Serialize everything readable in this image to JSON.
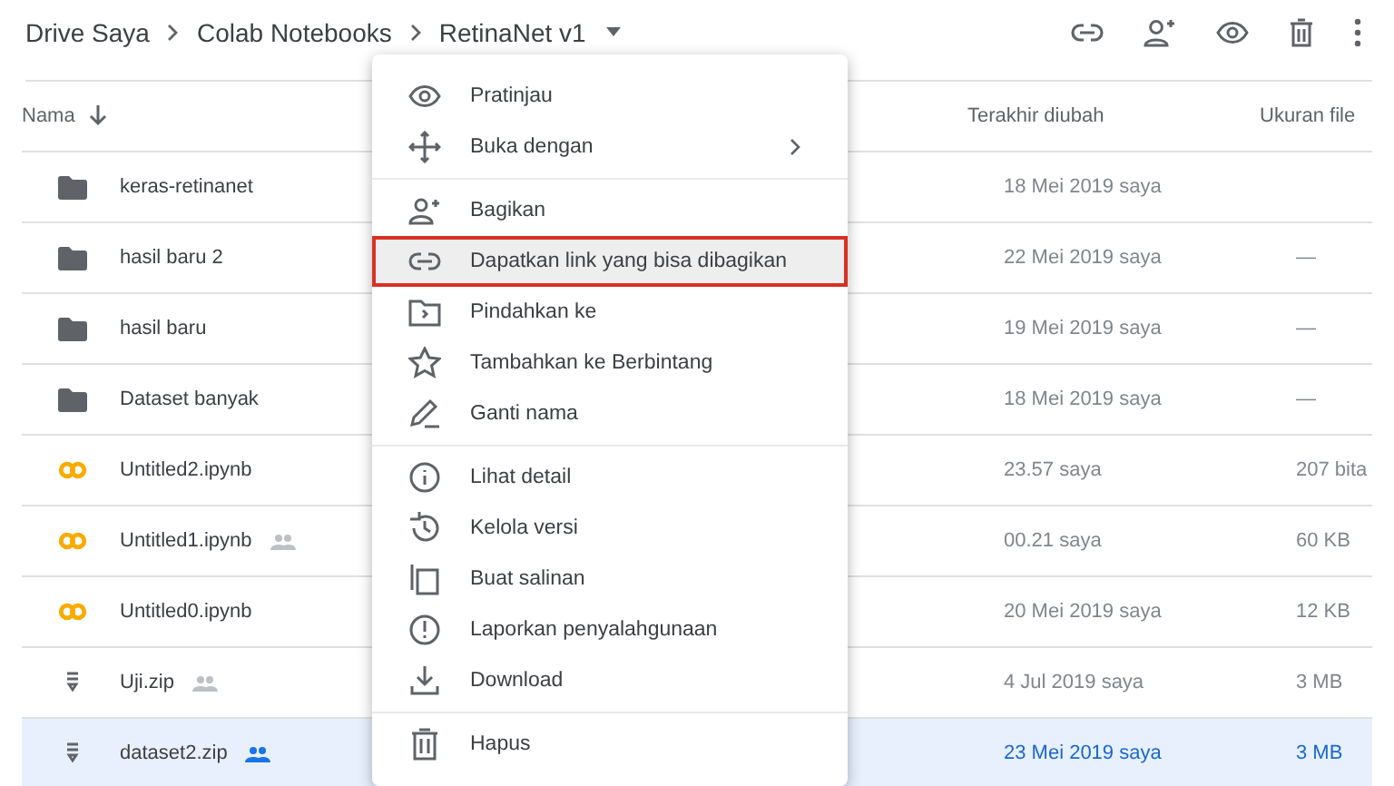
{
  "breadcrumb": [
    "Drive Saya",
    "Colab Notebooks",
    "RetinaNet v1"
  ],
  "table": {
    "columns": [
      "Nama",
      "Terakhir diubah",
      "Ukuran file"
    ],
    "rows": [
      {
        "kind": "folder",
        "name": "keras-retinanet",
        "shared": false,
        "modified": "18 Mei 2019 saya",
        "size": "",
        "selected": false
      },
      {
        "kind": "folder",
        "name": "hasil baru 2",
        "shared": false,
        "modified": "22 Mei 2019 saya",
        "size": "—",
        "selected": false
      },
      {
        "kind": "folder",
        "name": "hasil baru",
        "shared": false,
        "modified": "19 Mei 2019 saya",
        "size": "—",
        "selected": false
      },
      {
        "kind": "folder",
        "name": "Dataset banyak",
        "shared": false,
        "modified": "18 Mei 2019 saya",
        "size": "—",
        "selected": false
      },
      {
        "kind": "colab",
        "name": "Untitled2.ipynb",
        "shared": false,
        "modified": "23.57 saya",
        "size": "207 bita",
        "selected": false
      },
      {
        "kind": "colab",
        "name": "Untitled1.ipynb",
        "shared": true,
        "modified": "00.21 saya",
        "size": "60 KB",
        "selected": false
      },
      {
        "kind": "colab",
        "name": "Untitled0.ipynb",
        "shared": false,
        "modified": "20 Mei 2019 saya",
        "size": "12 KB",
        "selected": false
      },
      {
        "kind": "zip",
        "name": "Uji.zip",
        "shared": true,
        "modified": "4 Jul 2019 saya",
        "size": "3 MB",
        "selected": false
      },
      {
        "kind": "zip",
        "name": "dataset2.zip",
        "shared": true,
        "modified": "23 Mei 2019 saya",
        "size": "3 MB",
        "selected": true
      }
    ]
  },
  "menu": {
    "groups": [
      [
        {
          "label": "Pratinjau",
          "submenu": false,
          "selected": false
        },
        {
          "label": "Buka dengan",
          "submenu": true,
          "selected": false
        }
      ],
      [
        {
          "label": "Bagikan",
          "submenu": false,
          "selected": false
        },
        {
          "label": "Dapatkan link yang bisa dibagikan",
          "submenu": false,
          "selected": true
        },
        {
          "label": "Pindahkan ke",
          "submenu": false,
          "selected": false
        },
        {
          "label": "Tambahkan ke Berbintang",
          "submenu": false,
          "selected": false
        },
        {
          "label": "Ganti nama",
          "submenu": false,
          "selected": false
        }
      ],
      [
        {
          "label": "Lihat detail",
          "submenu": false,
          "selected": false
        },
        {
          "label": "Kelola versi",
          "submenu": false,
          "selected": false
        },
        {
          "label": "Buat salinan",
          "submenu": false,
          "selected": false
        },
        {
          "label": "Laporkan penyalahgunaan",
          "submenu": false,
          "selected": false
        },
        {
          "label": "Download",
          "submenu": false,
          "selected": false
        }
      ],
      [
        {
          "label": "Hapus",
          "submenu": false,
          "selected": false
        }
      ]
    ]
  }
}
